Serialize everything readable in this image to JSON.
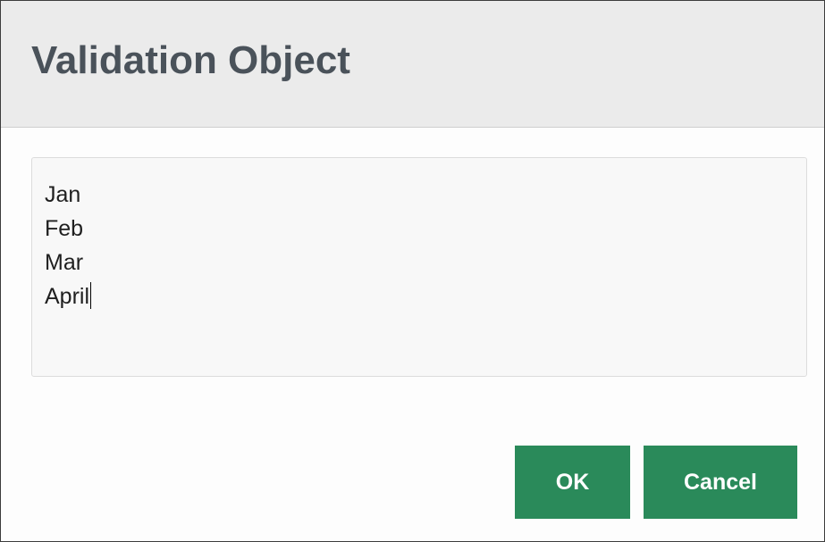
{
  "dialog": {
    "title": "Validation Object",
    "values_input": {
      "lines": [
        "Jan",
        "Feb",
        "Mar",
        "April"
      ]
    },
    "buttons": {
      "ok_label": "OK",
      "cancel_label": "Cancel"
    }
  },
  "colors": {
    "header_background": "#ebebeb",
    "title_text": "#4a525a",
    "button_background": "#2a8a5a",
    "button_text": "#ffffff"
  }
}
